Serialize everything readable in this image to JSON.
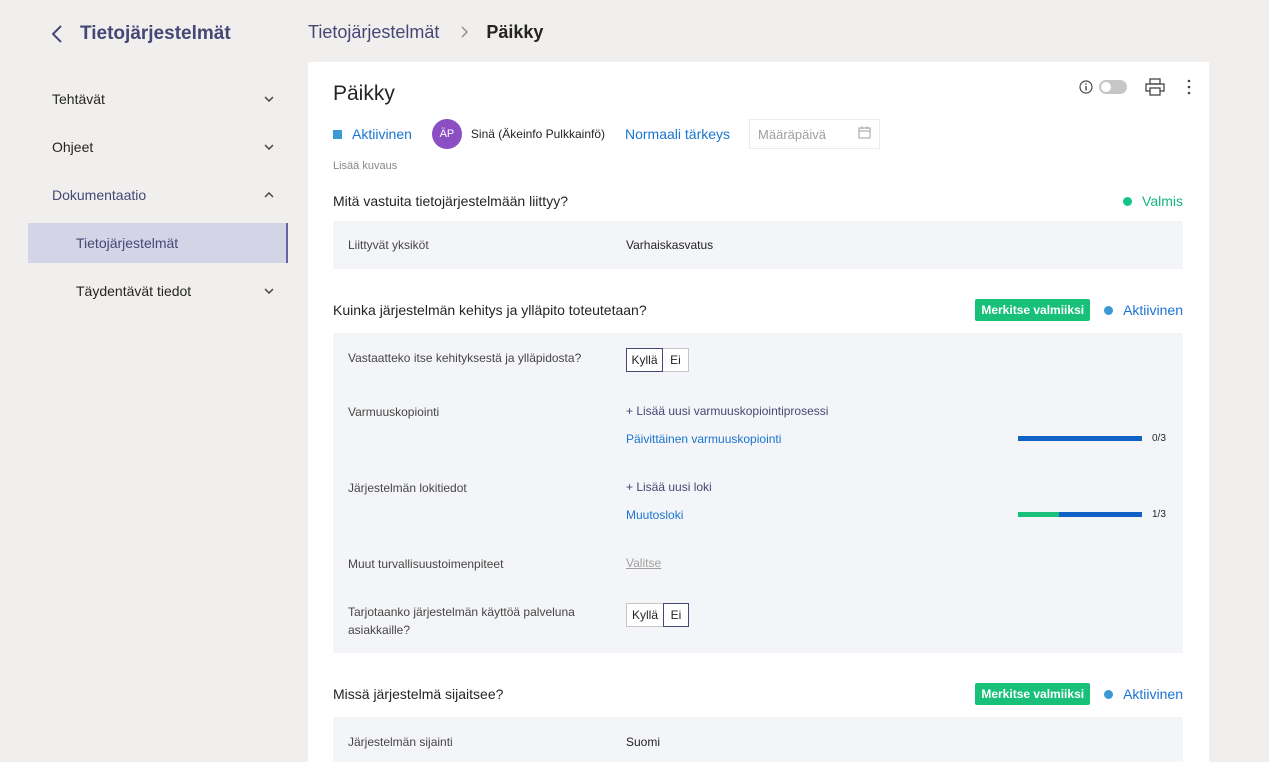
{
  "sidebar": {
    "title": "Tietojärjestelmät",
    "items": [
      {
        "label": "Tehtävät"
      },
      {
        "label": "Ohjeet"
      },
      {
        "label": "Dokumentaatio"
      },
      {
        "label": "Tietojärjestelmät"
      },
      {
        "label": "Täydentävät tiedot"
      }
    ]
  },
  "breadcrumb": {
    "parent": "Tietojärjestelmät",
    "current": "Päikky"
  },
  "page": {
    "title": "Päikky",
    "status": "Aktiivinen",
    "avatar_initials": "ÄP",
    "owner": "Sinä (Äkeinfo Pulkkainfö)",
    "priority": "Normaali tärkeys",
    "date_placeholder": "Määräpäivä",
    "add_description": "Lisää kuvaus"
  },
  "section1": {
    "title": "Mitä vastuita tietojärjestelmään liittyy?",
    "status": "Valmis",
    "rows": [
      {
        "label": "Liittyvät yksiköt",
        "value": "Varhaiskasvatus"
      }
    ]
  },
  "section2": {
    "title": "Kuinka järjestelmän kehitys ja ylläpito toteutetaan?",
    "mark_button": "Merkitse valmiiksi",
    "status": "Aktiivinen",
    "q_maintain": {
      "label": "Vastaatteko itse kehityksestä ja ylläpidosta?",
      "yes": "Kyllä",
      "no": "Ei",
      "selected": "yes"
    },
    "backup": {
      "label": "Varmuuskopiointi",
      "add": "+ Lisää uusi varmuuskopiointiprosessi",
      "item": "Päivittäinen varmuuskopiointi",
      "progress_done": 0,
      "progress_total": 3,
      "progress_label": "0/3"
    },
    "logs": {
      "label": "Järjestelmän lokitiedot",
      "add": "+ Lisää uusi loki",
      "item": "Muutosloki",
      "progress_done": 1,
      "progress_total": 3,
      "progress_label": "1/3"
    },
    "security": {
      "label": "Muut turvallisuustoimenpiteet",
      "choose": "Valitse"
    },
    "q_service": {
      "label": "Tarjotaanko järjestelmän käyttöä palveluna asiakkaille?",
      "yes": "Kyllä",
      "no": "Ei",
      "selected": "no"
    }
  },
  "section3": {
    "title": "Missä järjestelmä sijaitsee?",
    "mark_button": "Merkitse valmiiksi",
    "status": "Aktiivinen",
    "rows": [
      {
        "label": "Järjestelmän sijainti",
        "value": "Suomi"
      }
    ]
  },
  "colors": {
    "accent": "#464775",
    "link": "#1b75d0",
    "success": "#19c07a",
    "progress": "#1162c6"
  }
}
